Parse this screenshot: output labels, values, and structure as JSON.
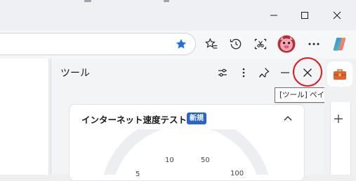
{
  "tools_pane": {
    "title": "ツール",
    "close_tooltip": "[ツール] ペインを閉じる"
  },
  "speedtest_card": {
    "title": "インターネット速度テスト",
    "badge": "新規",
    "gauge_labels": [
      "5",
      "10",
      "50",
      "100"
    ]
  },
  "colors": {
    "accent_blue": "#2b63c8",
    "highlight_red": "#e3151b",
    "favorite_star": "#1f6fe0"
  }
}
